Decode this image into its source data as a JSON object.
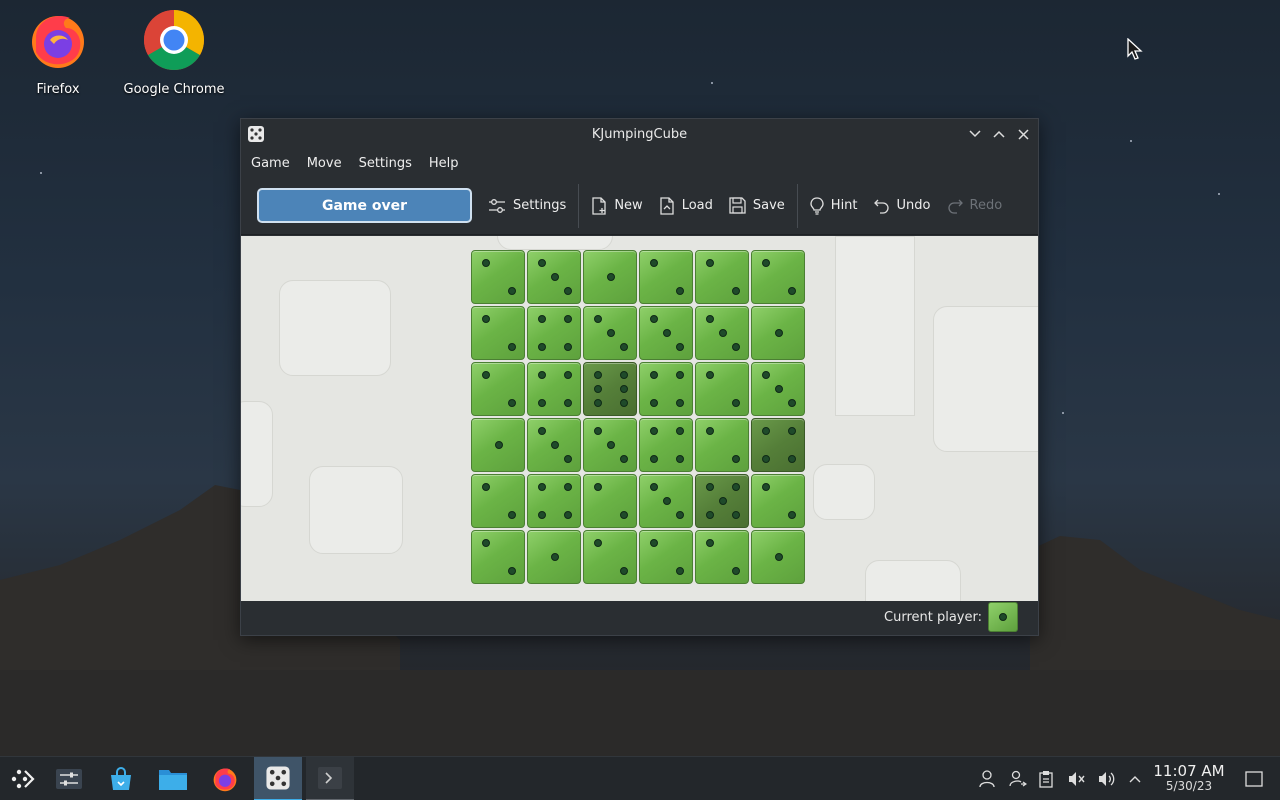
{
  "desktop": {
    "icons": [
      {
        "label": "Firefox"
      },
      {
        "label": "Google Chrome"
      }
    ]
  },
  "window": {
    "title": "KJumpingCube",
    "menu": [
      "Game",
      "Move",
      "Settings",
      "Help"
    ],
    "toolbar": {
      "status": "Game over",
      "settings": "Settings",
      "new": "New",
      "load": "Load",
      "save": "Save",
      "hint": "Hint",
      "undo": "Undo",
      "redo": "Redo"
    },
    "statusbar": {
      "current_player_label": "Current player:"
    }
  },
  "board": {
    "rows": 6,
    "cols": 6,
    "cells": [
      [
        2,
        3,
        1,
        2,
        2,
        2
      ],
      [
        2,
        4,
        3,
        3,
        3,
        1
      ],
      [
        2,
        4,
        6,
        4,
        2,
        3
      ],
      [
        1,
        3,
        3,
        4,
        2,
        4
      ],
      [
        2,
        4,
        2,
        3,
        5,
        2
      ],
      [
        2,
        1,
        2,
        2,
        2,
        1
      ]
    ],
    "dark_cells": [
      [
        2,
        2
      ],
      [
        3,
        5
      ],
      [
        4,
        4
      ]
    ],
    "colors": {
      "cube": "#6bb446",
      "cube_dark": "#557f39",
      "pip": "#1f4a2a"
    }
  },
  "taskbar": {
    "clock_time": "11:07 AM",
    "clock_date": "5/30/23",
    "tasks": [
      "app-launcher-icon",
      "system-settings-icon",
      "discover-icon",
      "file-manager-icon",
      "firefox-icon",
      "kjumpingcube-icon",
      "konsole-icon"
    ],
    "tray": [
      "user-icon",
      "kde-connect-icon",
      "clipboard-icon",
      "microphone-muted-icon",
      "volume-icon",
      "expand-tray-icon"
    ]
  }
}
